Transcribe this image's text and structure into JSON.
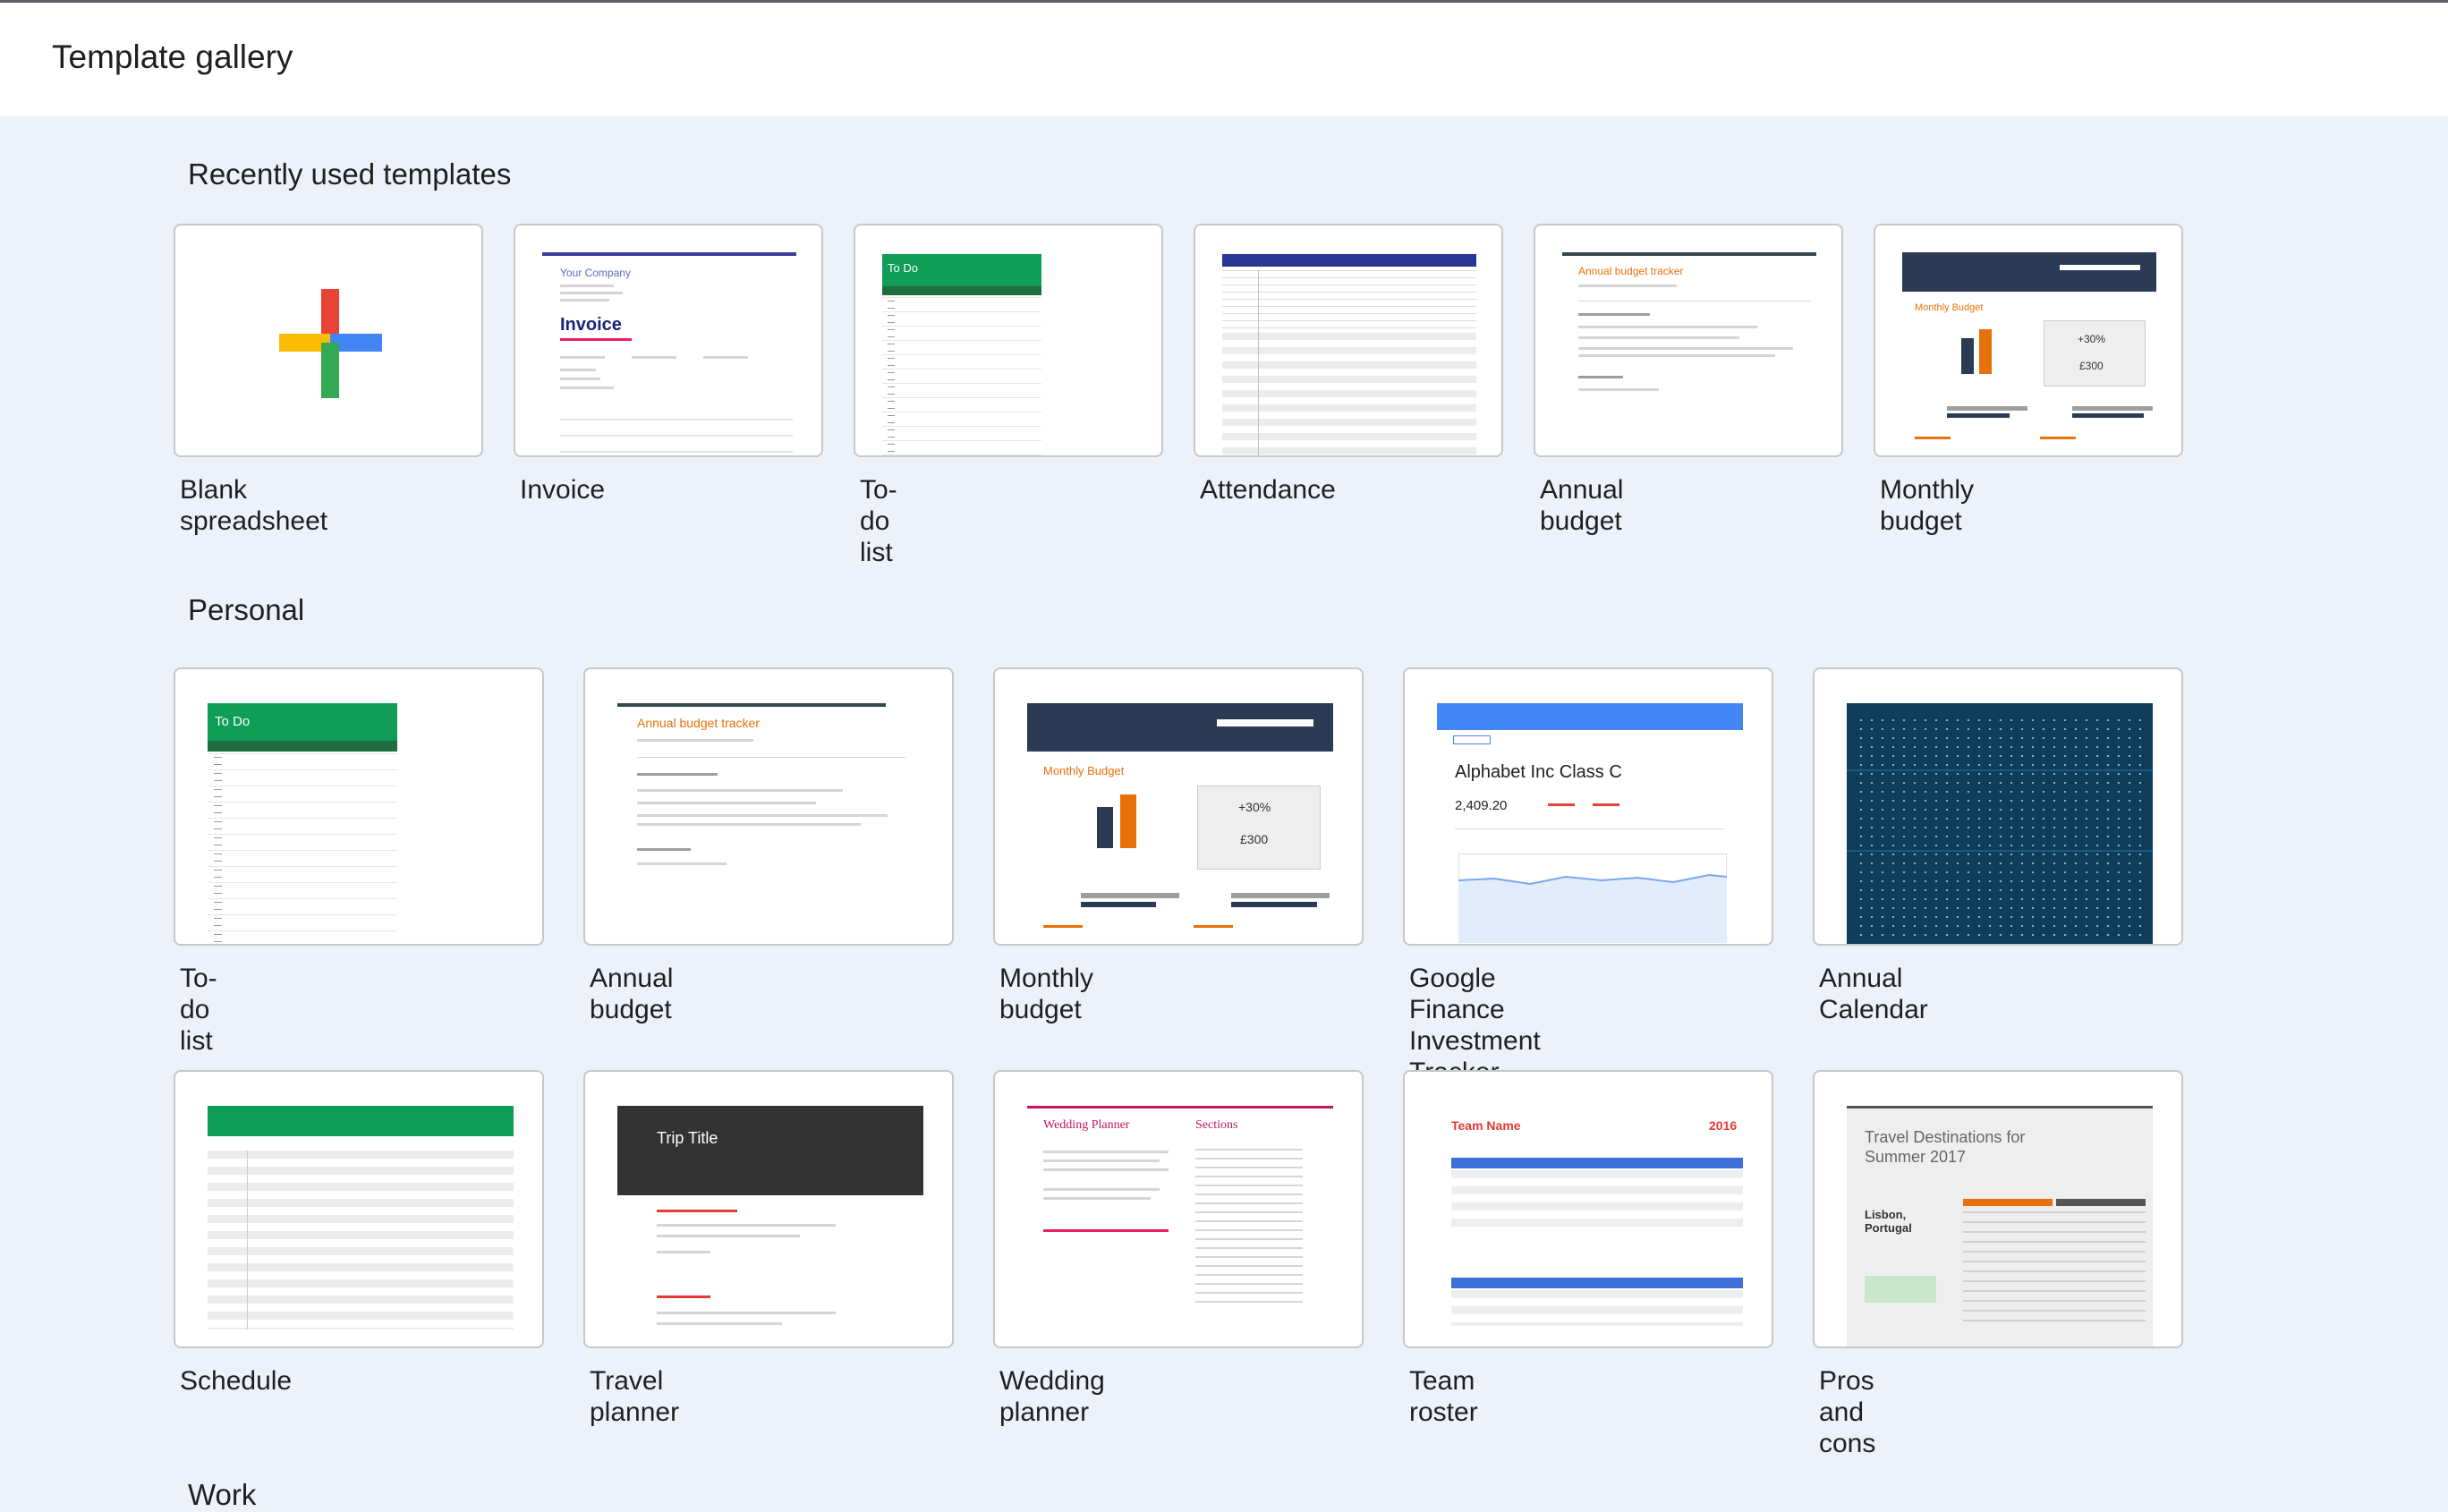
{
  "header": {
    "title": "Template gallery"
  },
  "sections": {
    "recent": {
      "title": "Recently used templates",
      "items": [
        "Blank spreadsheet",
        "Invoice",
        "To-do list",
        "Attendance",
        "Annual budget",
        "Monthly budget"
      ]
    },
    "personal": {
      "title": "Personal",
      "items": [
        "To-do list",
        "Annual budget",
        "Monthly budget",
        "Google Finance Investment Tracker",
        "Annual Calendar",
        "Schedule",
        "Travel planner",
        "Wedding planner",
        "Team roster",
        "Pros and cons"
      ]
    },
    "work": {
      "title": "Work"
    }
  },
  "previews": {
    "invoice": {
      "company": "Your Company",
      "heading": "Invoice"
    },
    "todo": {
      "heading": "To Do"
    },
    "annual": {
      "heading": "Annual budget tracker"
    },
    "monthly": {
      "heading": "Monthly Budget",
      "pct": "+30%",
      "amount": "£300"
    },
    "finance": {
      "heading": "Alphabet Inc Class C",
      "price": "2,409.20"
    },
    "trip": {
      "heading": "Trip Title"
    },
    "wedding": {
      "heading": "Wedding Planner",
      "sections": "Sections"
    },
    "roster": {
      "heading": "Team Name",
      "year": "2016"
    },
    "pros": {
      "heading": "Travel Destinations for Summer 2017",
      "city": "Lisbon, Portugal"
    }
  },
  "colors": {
    "background": "#edf2fa",
    "green": "#0f9d58",
    "navy": "#2b3a55",
    "orange": "#e8710a",
    "calendar": "#0f3d5c"
  }
}
